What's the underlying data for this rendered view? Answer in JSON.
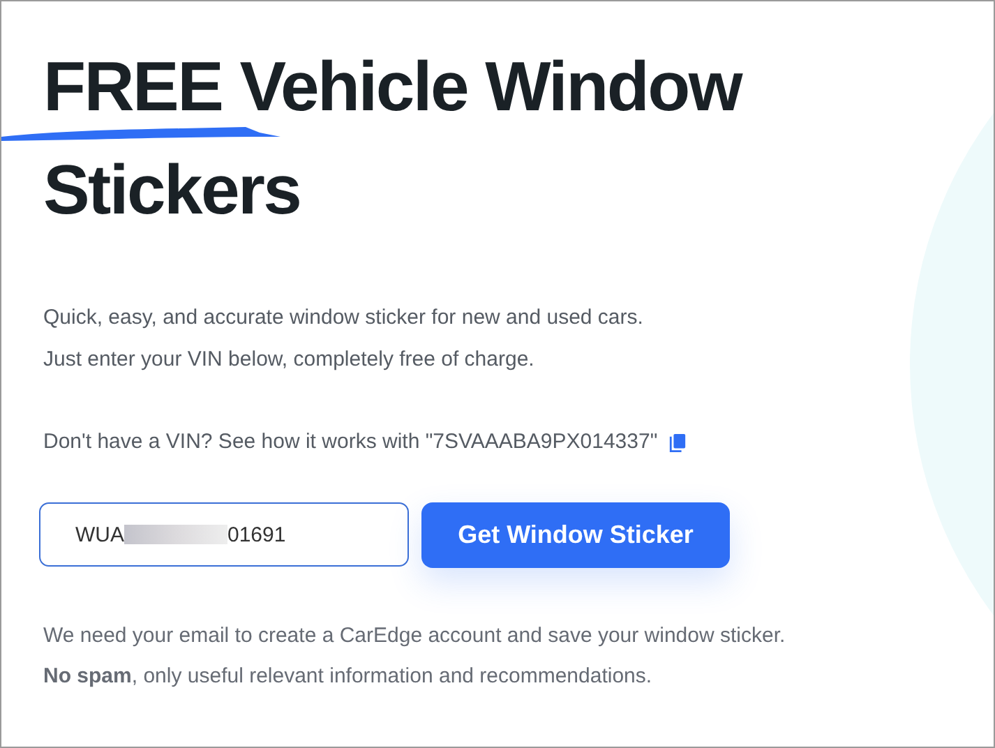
{
  "heading": {
    "lines": [
      "FREE Vehicle Window",
      "Stickers"
    ],
    "underlined": true
  },
  "intro": [
    "Quick, easy, and accurate window sticker for new and used cars.",
    "Just enter your VIN below, completely free of charge."
  ],
  "sample_vin": {
    "text": "Don't have a VIN? See how it works with \"7SVAAABA9PX014337\""
  },
  "vin_field": {
    "value_start": "WUA",
    "value_end": "01691",
    "redacted": true
  },
  "submit_button": {
    "label": "Get Window Sticker"
  },
  "notes": [
    "We need your email to create a CarEdge account and save your window sticker.",
    "**No spam**, only useful relevant information and recommendations."
  ]
}
